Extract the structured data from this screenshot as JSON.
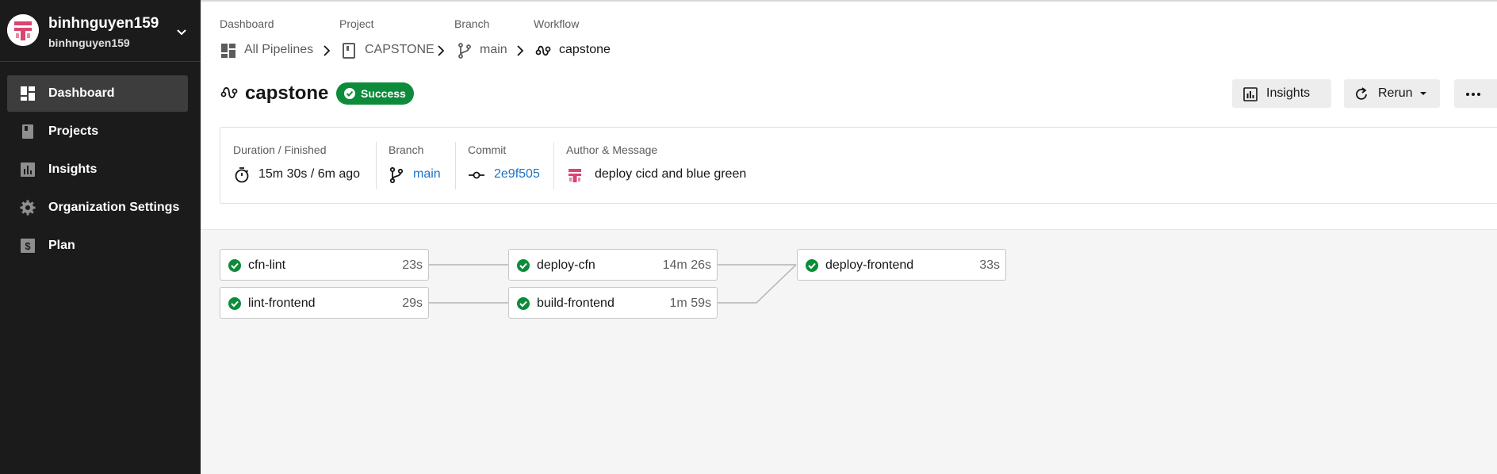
{
  "sidebar": {
    "org_name": "binhnguyen159",
    "org_user": "binhnguyen159",
    "items": [
      {
        "label": "Dashboard",
        "active": true,
        "icon": "dashboard-icon"
      },
      {
        "label": "Projects",
        "icon": "book-icon"
      },
      {
        "label": "Insights",
        "icon": "chart-icon"
      },
      {
        "label": "Organization Settings",
        "icon": "gear-icon"
      },
      {
        "label": "Plan",
        "icon": "dollar-icon"
      }
    ]
  },
  "breadcrumb": {
    "dashboard_label": "Dashboard",
    "dashboard_value": "All Pipelines",
    "project_label": "Project",
    "project_value": "CAPSTONE",
    "branch_label": "Branch",
    "branch_value": "main",
    "workflow_label": "Workflow",
    "workflow_value": "capstone"
  },
  "workflow": {
    "title": "capstone",
    "status": "Success",
    "status_color": "#0c8c3a"
  },
  "actions": {
    "insights_label": "Insights",
    "rerun_label": "Rerun"
  },
  "info": {
    "duration_label": "Duration / Finished",
    "duration_value": "15m 30s / 6m ago",
    "branch_label": "Branch",
    "branch_value": "main",
    "commit_label": "Commit",
    "commit_value": "2e9f505",
    "author_label": "Author & Message",
    "message": "deploy cicd and blue green"
  },
  "jobs": [
    {
      "name": "cfn-lint",
      "duration": "23s",
      "status": "success"
    },
    {
      "name": "lint-frontend",
      "duration": "29s",
      "status": "success"
    },
    {
      "name": "deploy-cfn",
      "duration": "14m 26s",
      "status": "success"
    },
    {
      "name": "build-frontend",
      "duration": "1m 59s",
      "status": "success"
    },
    {
      "name": "deploy-frontend",
      "duration": "33s",
      "status": "success"
    }
  ],
  "colors": {
    "sidebar_bg": "#1b1b1b",
    "success": "#0c8c3a",
    "link": "#1a73c7"
  }
}
